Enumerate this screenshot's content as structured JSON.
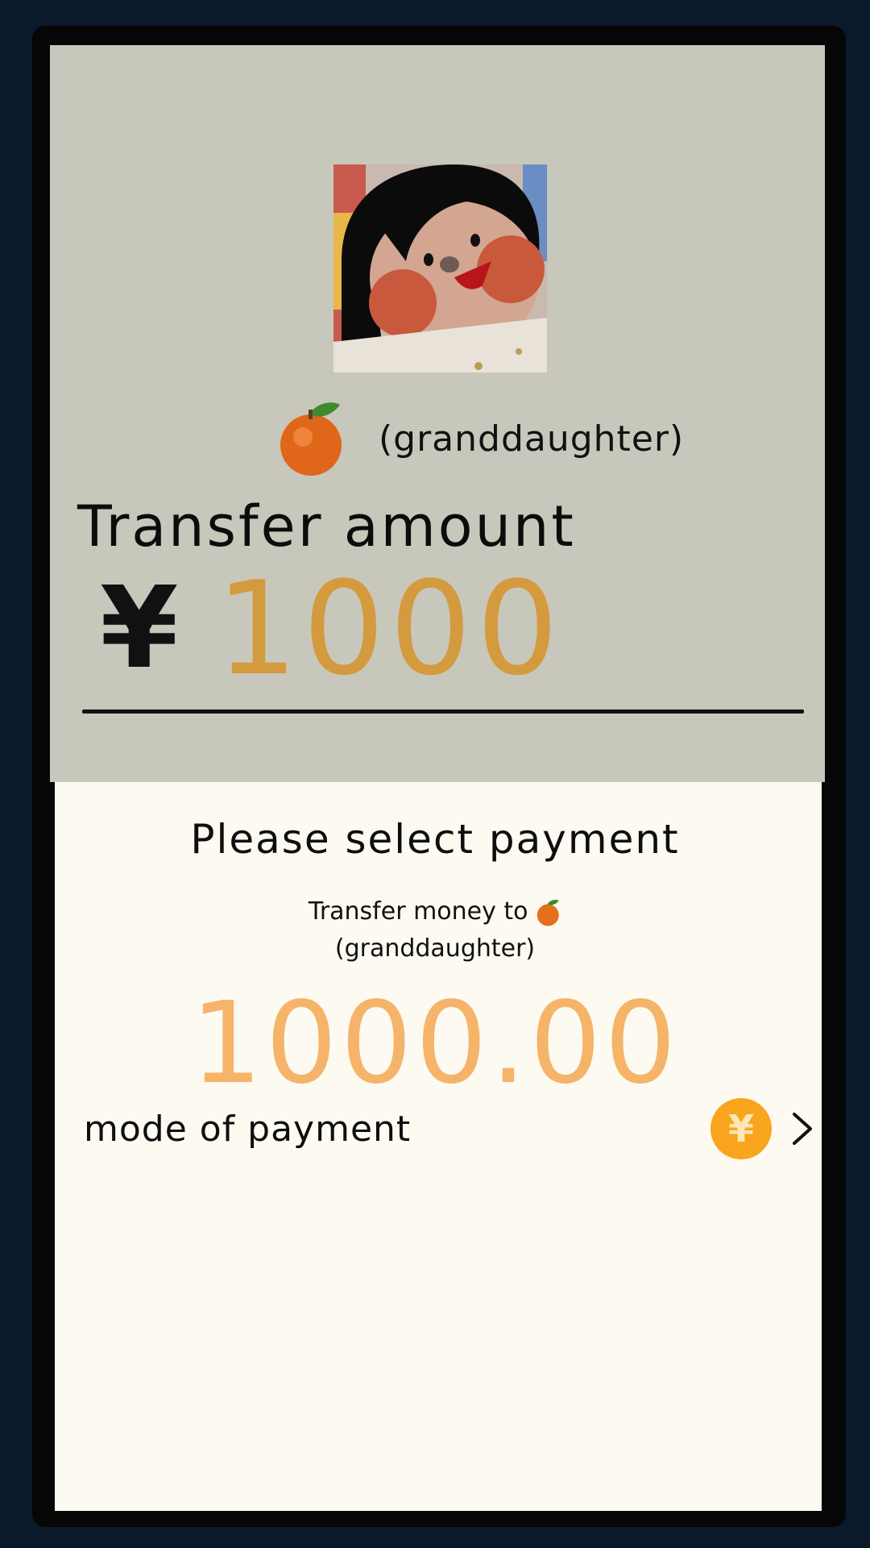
{
  "recipient": {
    "name": "(granddaughter)",
    "avatar_icon": "girl-avatar-image",
    "emoji_icon": "orange-icon"
  },
  "transfer": {
    "label": "Transfer amount",
    "currency_symbol": "¥",
    "amount_value": "1000"
  },
  "payment_sheet": {
    "title": "Please select payment",
    "subtitle_prefix": "Transfer money to",
    "subtitle_name": "(granddaughter)",
    "amount": "1000.00",
    "mode_label": "mode of payment",
    "mode_icon": "yuan-coin-icon",
    "coin_glyph": "¥",
    "chevron_icon": "chevron-right-icon"
  },
  "colors": {
    "background": "#0b1a2b",
    "top_panel": "#c8c7bc",
    "sheet": "#fcfaf1",
    "amount_orange": "#d49a3e",
    "sheet_amount": "#f5b46a",
    "coin": "#f9a51e"
  }
}
